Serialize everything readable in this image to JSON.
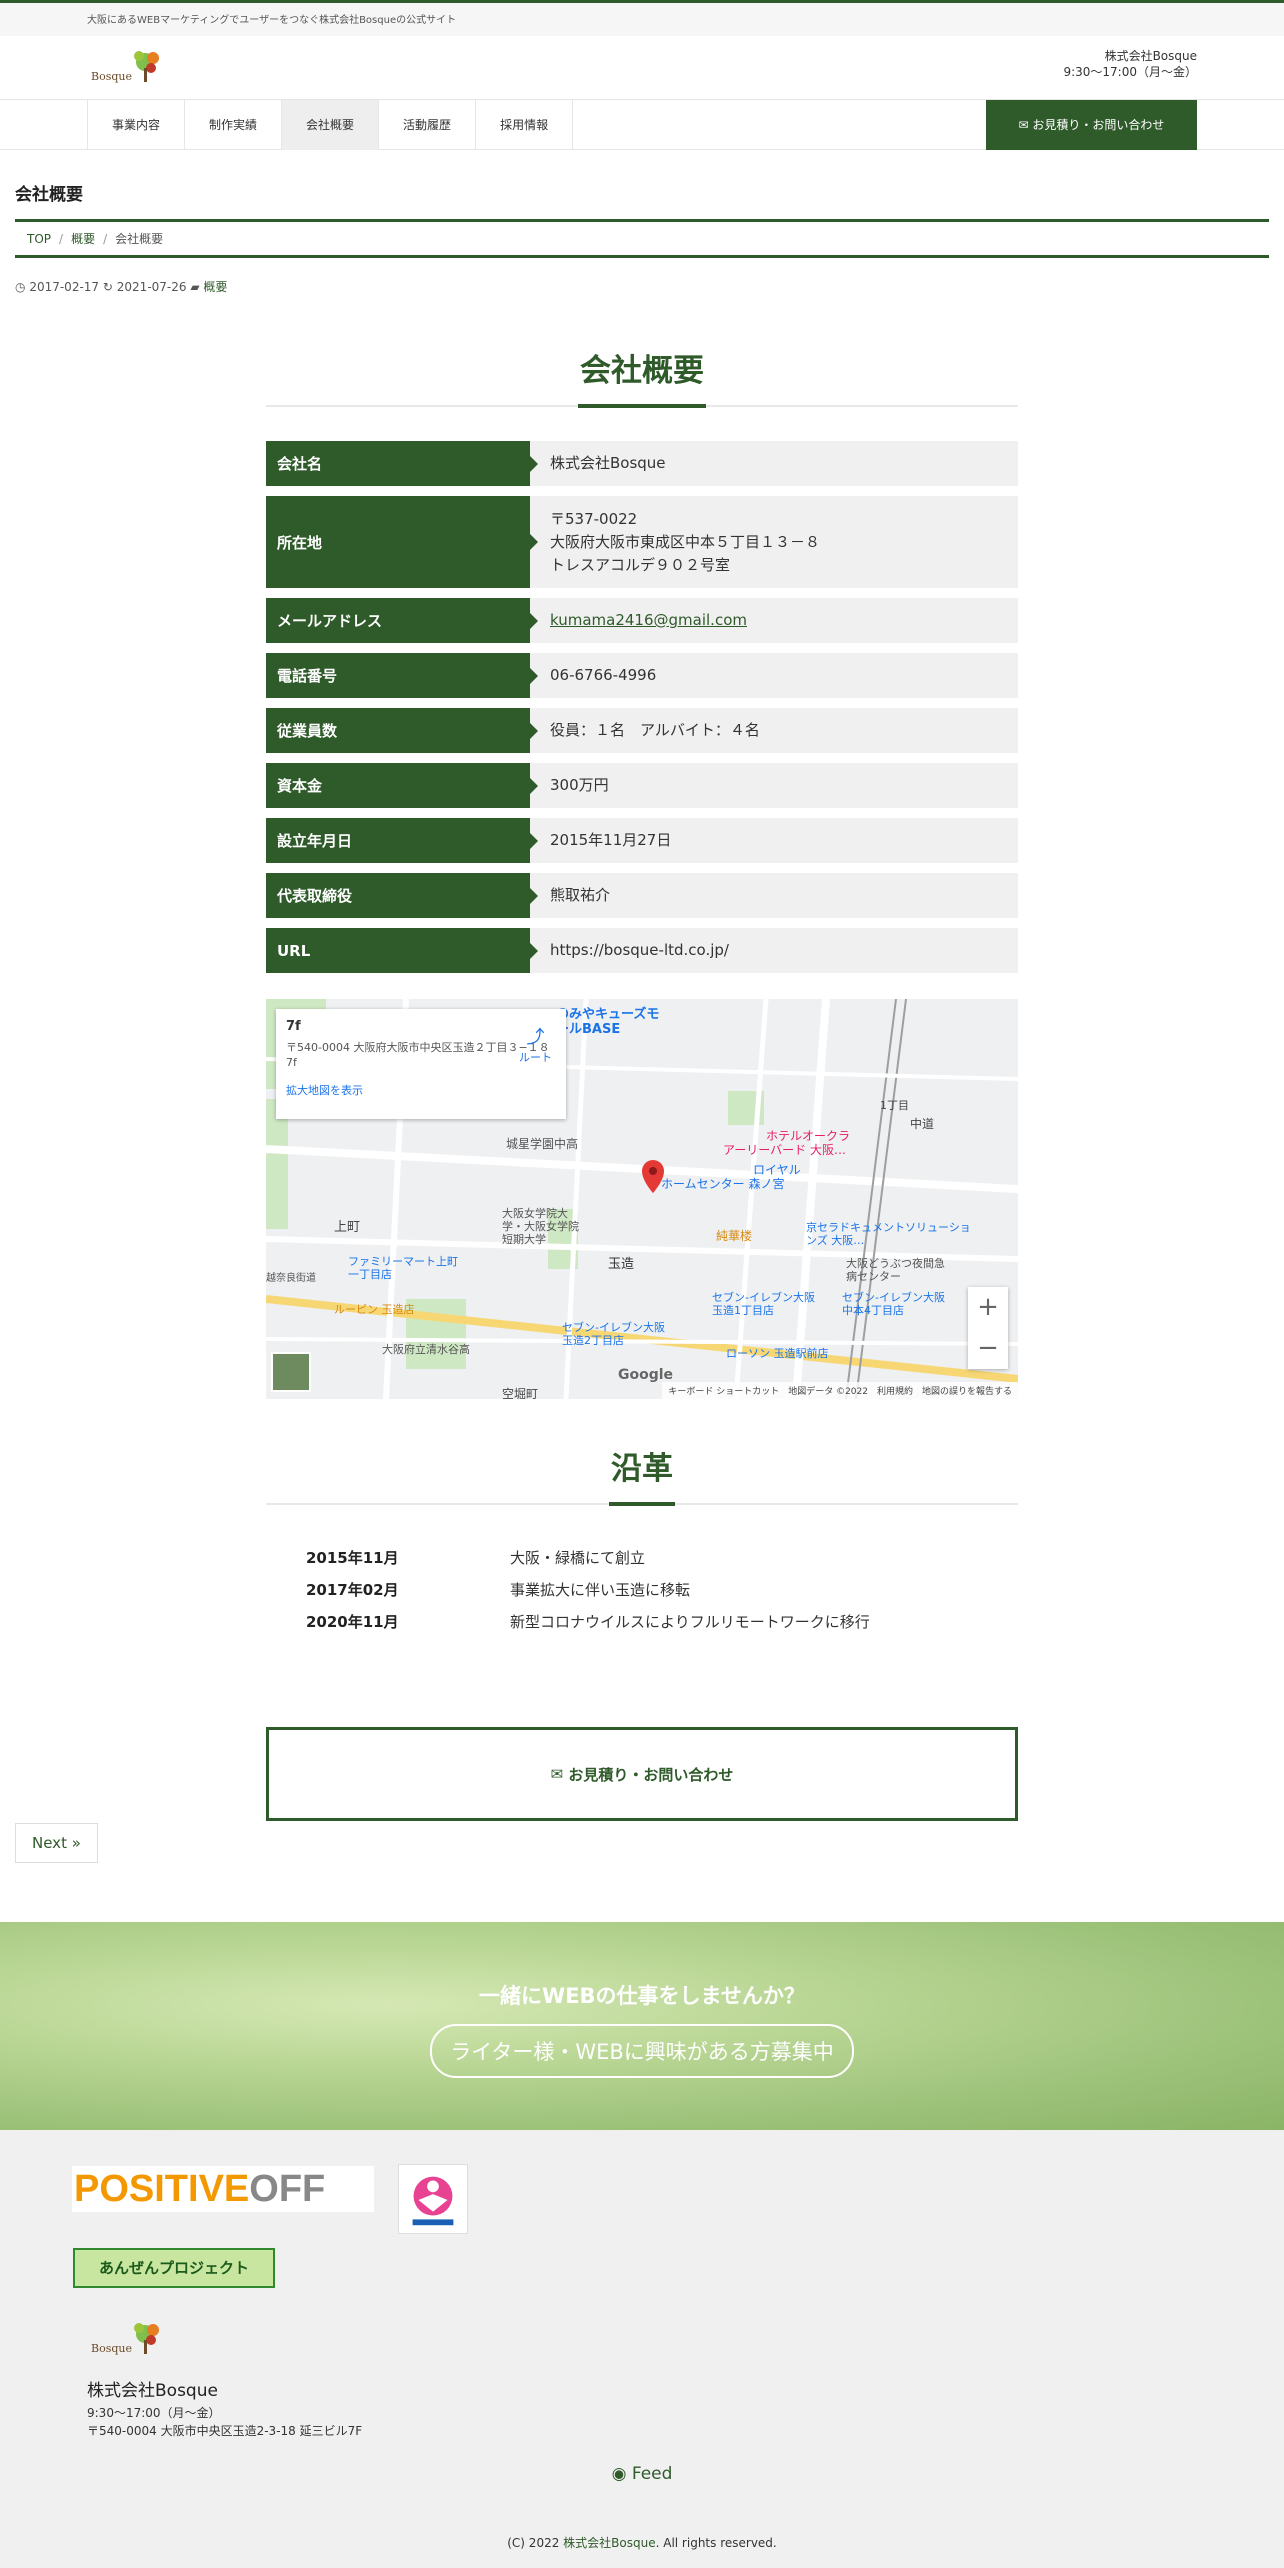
{
  "topbar": {
    "tagline": "大阪にあるWEBマーケティングでユーザーをつなぐ株式会社Bosqueの公式サイト"
  },
  "header": {
    "logo_text": "Bosque",
    "company": "株式会社Bosque",
    "hours": "9:30～17:00（月～金）"
  },
  "nav": {
    "items": [
      {
        "label": "事業内容",
        "active": false
      },
      {
        "label": "制作実績",
        "active": false
      },
      {
        "label": "会社概要",
        "active": true
      },
      {
        "label": "活動履歴",
        "active": false
      },
      {
        "label": "採用情報",
        "active": false
      }
    ],
    "contact": "お見積り・お問い合わせ"
  },
  "page": {
    "title": "会社概要",
    "breadcrumb": [
      "TOP",
      "概要",
      "会社概要"
    ],
    "posted": "2017-02-17",
    "updated": "2021-07-26",
    "category": "概要"
  },
  "company_section": {
    "heading": "会社概要",
    "rows": [
      {
        "key": "会社名",
        "lines": [
          "株式会社Bosque"
        ]
      },
      {
        "key": "所在地",
        "lines": [
          "〒537-0022",
          "大阪府大阪市東成区中本５丁目１３－８",
          "トレスアコルデ９０２号室"
        ]
      },
      {
        "key": "メールアドレス",
        "lines": [
          "kumama2416@gmail.com"
        ],
        "link": true
      },
      {
        "key": "電話番号",
        "lines": [
          "06-6766-4996"
        ]
      },
      {
        "key": "従業員数",
        "lines": [
          "役員：１名　アルバイト：４名"
        ]
      },
      {
        "key": "資本金",
        "lines": [
          "300万円"
        ]
      },
      {
        "key": "設立年月日",
        "lines": [
          "2015年11月27日"
        ]
      },
      {
        "key": "代表取締役",
        "lines": [
          "熊取祐介"
        ]
      },
      {
        "key": "URL",
        "lines": [
          "https://bosque-ltd.co.jp/"
        ]
      }
    ]
  },
  "map": {
    "card_title": "7f",
    "card_address": "〒540-0004 大阪府大阪市中央区玉造２丁目３−１８ 7f",
    "card_link": "拡大地図を表示",
    "route": "ルート",
    "labels": [
      "のみやキューズモールBASE",
      "城星学園中高",
      "ホテルオークラ",
      "アーリーバード 大阪…",
      "ホームセンター 森ノ宮",
      "ロイヤル",
      "上町",
      "大阪女学院大学・大阪女学院短期大学",
      "ファミリーマート上町一丁目店",
      "玉造",
      "純華楼",
      "京セラドキュメントソリューションズ 大阪…",
      "大阪どうぶつ夜間急病センター",
      "セブン-イレブン大阪玉造1丁目店",
      "セブン-イレブン大阪玉造2丁目店",
      "セブン-イレブン大阪中本4丁目店",
      "ルーピン 玉造店",
      "ローソン 玉造駅前店",
      "大阪府立清水谷高",
      "越奈良街道",
      "空堀町",
      "中道",
      "1丁目"
    ],
    "footer": "キーボード ショートカット　地図データ ©2022　利用規約　地図の誤りを報告する",
    "google": "Google"
  },
  "history": {
    "heading": "沿革",
    "items": [
      {
        "date": "2015年11月",
        "text": "大阪・緑橋にて創立"
      },
      {
        "date": "2017年02月",
        "text": "事業拡大に伴い玉造に移転"
      },
      {
        "date": "2020年11月",
        "text": "新型コロナウイルスによりフルリモートワークに移行"
      }
    ]
  },
  "cta": {
    "label": "お見積り・お問い合わせ"
  },
  "pager": {
    "next": "Next »"
  },
  "banner": {
    "line1": "一緒にWEBの仕事をしませんか？",
    "line2": "ライター様・WEBに興味がある方募集中"
  },
  "footer": {
    "positive": "POSITIVE",
    "off": "OFF",
    "anzen": "あんぜんプロジェクト",
    "logo_text": "Bosque",
    "company": "株式会社Bosque",
    "hours": "9:30～17:00（月～金）",
    "address": "〒540-0004 大阪市中央区玉造2-3-18 延三ビル7F",
    "feed": "Feed",
    "copy_prefix": "(C) 2022 ",
    "copy_company": "株式会社Bosque",
    "copy_suffix": ". All rights reserved."
  },
  "colors": {
    "brand_green": "#2f5a2a",
    "link_blue": "#1a73e8",
    "pin_red": "#e53935"
  }
}
